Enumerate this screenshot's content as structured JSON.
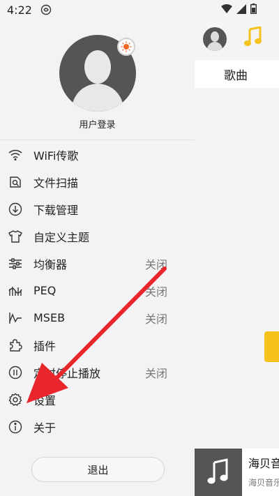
{
  "status": {
    "time": "4:22"
  },
  "drawer": {
    "login_label": "用户登录",
    "items": [
      {
        "label": "WiFi传歌",
        "icon": "wifi-icon"
      },
      {
        "label": "文件扫描",
        "icon": "file-scan-icon"
      },
      {
        "label": "下载管理",
        "icon": "download-icon"
      },
      {
        "label": "自定义主题",
        "icon": "tshirt-icon"
      },
      {
        "label": "均衡器",
        "icon": "equalizer-icon",
        "value": "关闭"
      },
      {
        "label": "PEQ",
        "icon": "peq-icon",
        "value": "关闭"
      },
      {
        "label": "MSEB",
        "icon": "mseb-icon",
        "value": "关闭"
      },
      {
        "label": "插件",
        "icon": "puzzle-icon"
      },
      {
        "label": "定时停止播放",
        "icon": "timer-icon",
        "value": "关闭"
      },
      {
        "label": "设置",
        "icon": "gear-icon"
      },
      {
        "label": "关于",
        "icon": "info-icon"
      }
    ],
    "logout_label": "退出"
  },
  "content": {
    "tab_label": "歌曲",
    "player_title": "海贝音",
    "player_subtitle": "海贝音乐"
  },
  "colors": {
    "accent": "#f5c21b",
    "annotation_arrow": "#e8262b"
  }
}
